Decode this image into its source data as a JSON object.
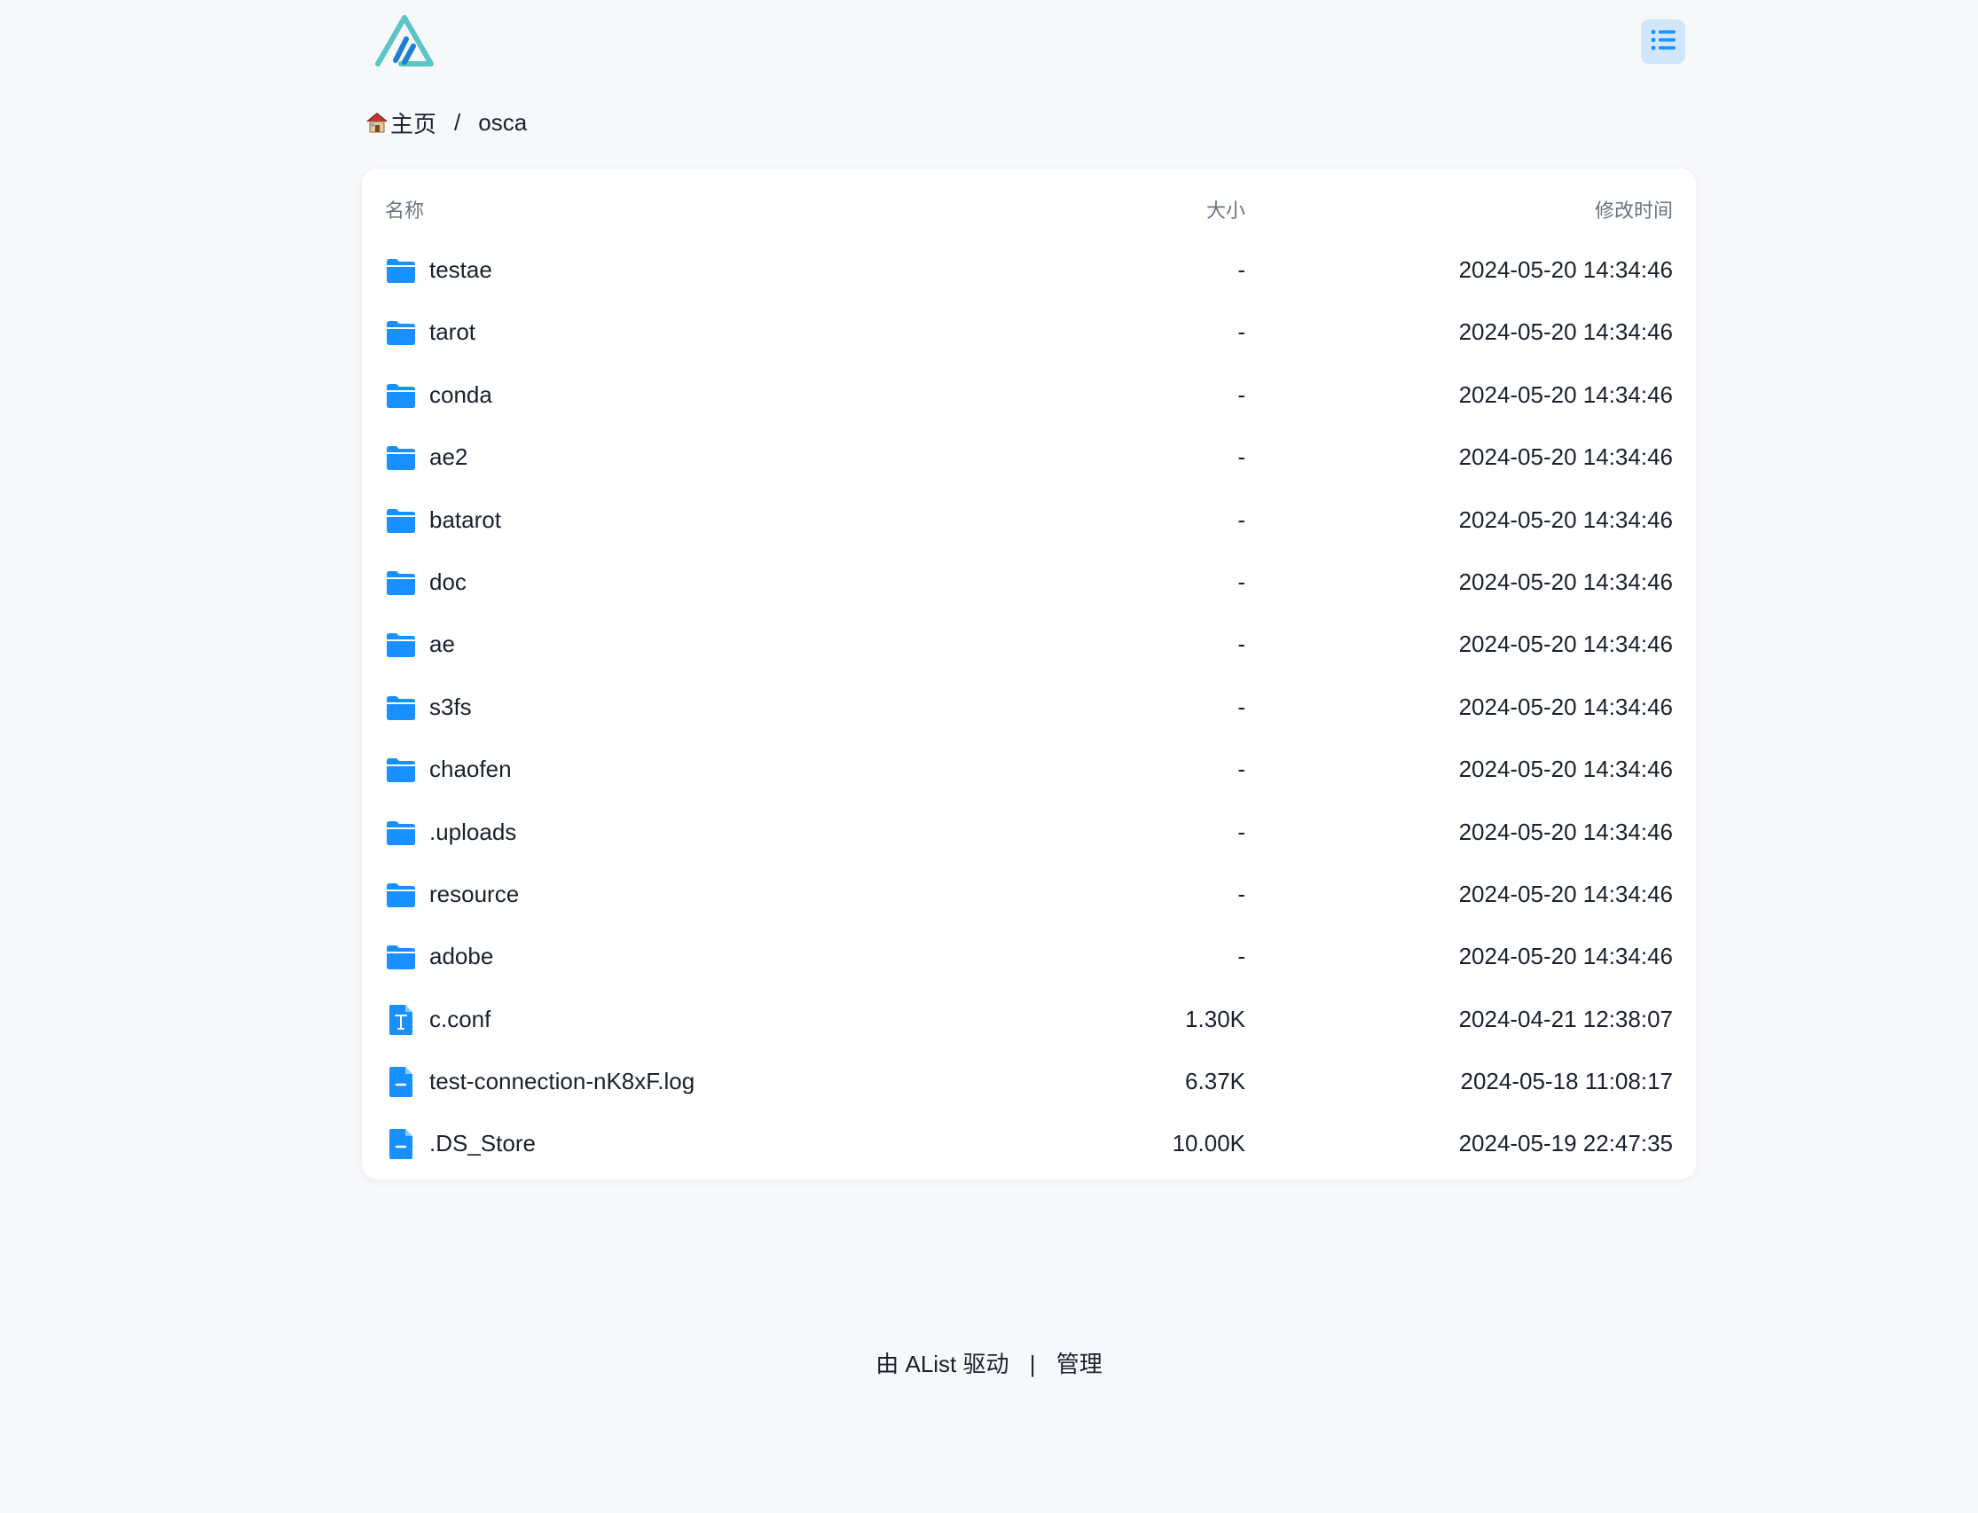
{
  "header": {
    "logo_icon": "alist-logo-icon",
    "layout_toggle_icon": "list-icon"
  },
  "breadcrumb": {
    "home_icon": "house-icon",
    "home_label": "主页",
    "separator": "/",
    "current": "osca"
  },
  "table": {
    "columns": {
      "name": "名称",
      "size": "大小",
      "modified": "修改时间"
    },
    "rows": [
      {
        "type": "folder",
        "name": "testae",
        "size": "-",
        "modified": "2024-05-20 14:34:46"
      },
      {
        "type": "folder",
        "name": "tarot",
        "size": "-",
        "modified": "2024-05-20 14:34:46"
      },
      {
        "type": "folder",
        "name": "conda",
        "size": "-",
        "modified": "2024-05-20 14:34:46"
      },
      {
        "type": "folder",
        "name": "ae2",
        "size": "-",
        "modified": "2024-05-20 14:34:46"
      },
      {
        "type": "folder",
        "name": "batarot",
        "size": "-",
        "modified": "2024-05-20 14:34:46"
      },
      {
        "type": "folder",
        "name": "doc",
        "size": "-",
        "modified": "2024-05-20 14:34:46"
      },
      {
        "type": "folder",
        "name": "ae",
        "size": "-",
        "modified": "2024-05-20 14:34:46"
      },
      {
        "type": "folder",
        "name": "s3fs",
        "size": "-",
        "modified": "2024-05-20 14:34:46"
      },
      {
        "type": "folder",
        "name": "chaofen",
        "size": "-",
        "modified": "2024-05-20 14:34:46"
      },
      {
        "type": "folder",
        "name": ".uploads",
        "size": "-",
        "modified": "2024-05-20 14:34:46"
      },
      {
        "type": "folder",
        "name": "resource",
        "size": "-",
        "modified": "2024-05-20 14:34:46"
      },
      {
        "type": "folder",
        "name": "adobe",
        "size": "-",
        "modified": "2024-05-20 14:34:46"
      },
      {
        "type": "text",
        "name": "c.conf",
        "size": "1.30K",
        "modified": "2024-04-21 12:38:07"
      },
      {
        "type": "file",
        "name": "test-connection-nK8xF.log",
        "size": "6.37K",
        "modified": "2024-05-18 11:08:17"
      },
      {
        "type": "file",
        "name": ".DS_Store",
        "size": "10.00K",
        "modified": "2024-05-19 22:47:35"
      }
    ]
  },
  "footer": {
    "powered": "由 AList 驱动",
    "separator": "|",
    "manage": "管理"
  },
  "colors": {
    "accent": "#1890ff",
    "folder": "#1890ff",
    "logo_teal": "#5bc4c4",
    "logo_blue": "#1e7fd0",
    "layout_btn_bg": "#cfe6fb",
    "background": "#f7f8fa"
  }
}
